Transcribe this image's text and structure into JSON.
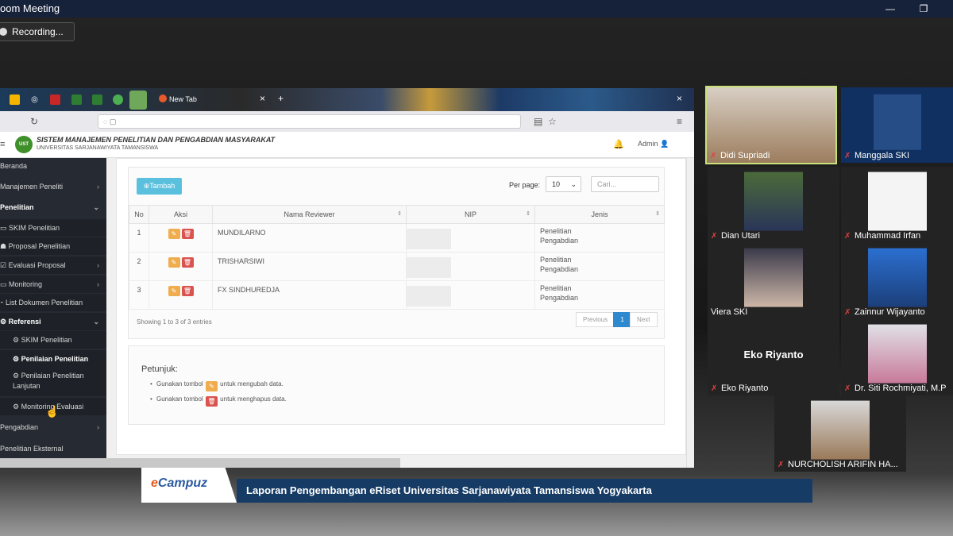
{
  "window": {
    "title": "oom Meeting",
    "minimize_icon": "minimize-icon",
    "restore_icon": "restore-icon"
  },
  "recording": {
    "label": "Recording..."
  },
  "browser": {
    "tabs": [
      {
        "label": "New Tab"
      }
    ],
    "address": {
      "url": ""
    }
  },
  "app": {
    "title": "SISTEM MANAJEMEN PENELITIAN DAN PENGABDIAN MASYARAKAT",
    "subtitle": "UNIVERSITAS SARJANAWIYATA TAMANSISWA",
    "logo_text": "UST",
    "user": "Admin"
  },
  "sidebar": {
    "items": [
      {
        "label": "Beranda"
      },
      {
        "label": "Manajemen Peneliti"
      },
      {
        "label": "Penelitian"
      },
      {
        "label": "SKIM Penelitian"
      },
      {
        "label": "Proposal Penelitian"
      },
      {
        "label": "Evaluasi Proposal"
      },
      {
        "label": "Monitoring"
      },
      {
        "label": "List Dokumen Penelitian"
      },
      {
        "label": "Referensi"
      },
      {
        "label": "SKIM Penelitian"
      },
      {
        "label": "Penilaian Penelitian"
      },
      {
        "label": "Penilaian Penelitian Lanjutan"
      },
      {
        "label": "Monitoring Evaluasi"
      },
      {
        "label": "Pengabdian"
      },
      {
        "label": "Penelitian Eksternal"
      }
    ]
  },
  "toolbar": {
    "add_label": "Tambah",
    "per_page_label": "Per page:",
    "per_page_value": "10",
    "search_placeholder": "Cari..."
  },
  "table": {
    "headers": [
      "No",
      "Aksi",
      "Nama Reviewer",
      "NIP",
      "Jenis"
    ],
    "rows": [
      {
        "no": "1",
        "nama": "MUNDILARNO",
        "nip": "",
        "jenis1": "Penelitian",
        "jenis2": "Pengabdian"
      },
      {
        "no": "2",
        "nama": "TRISHARSIWI",
        "nip": "",
        "jenis1": "Penelitian",
        "jenis2": "Pengabdian"
      },
      {
        "no": "3",
        "nama": "FX SINDHUREDJA",
        "nip": "",
        "jenis1": "Penelitian",
        "jenis2": "Pengabdian"
      }
    ],
    "showing": "Showing 1 to 3 of 3 entries"
  },
  "pagination": {
    "previous": "Previous",
    "current": "1",
    "next": "Next"
  },
  "help": {
    "title": "Petunjuk:",
    "prefix": "Gunakan tombol",
    "edit_hint": "untuk mengubah data.",
    "delete_hint": "untuk menghapus data."
  },
  "participants": [
    {
      "name": "Didi Supriadi"
    },
    {
      "name": "Manggala SKI"
    },
    {
      "name": "Dian Utari"
    },
    {
      "name": "Muhammad Irfan"
    },
    {
      "name": "Viera SKI"
    },
    {
      "name": "Zainnur Wijayanto"
    },
    {
      "name": "Eko Riyanto",
      "display": "Eko Riyanto"
    },
    {
      "name": "Dr. Siti Rochmiyati, M.P"
    },
    {
      "name": "NURCHOLISH ARIFIN HA..."
    }
  ],
  "caption": {
    "brand_prefix": "e",
    "brand_rest": "Campuz",
    "text": "Laporan Pengembangan eRiset Universitas Sarjanawiyata Tamansiswa Yogyakarta"
  },
  "colors": {
    "info": "#5bc0de",
    "warning": "#f0ad4e",
    "danger": "#d9534f",
    "primary": "#2f89cf",
    "banner": "#163c66",
    "sidebar": "#262b33"
  }
}
